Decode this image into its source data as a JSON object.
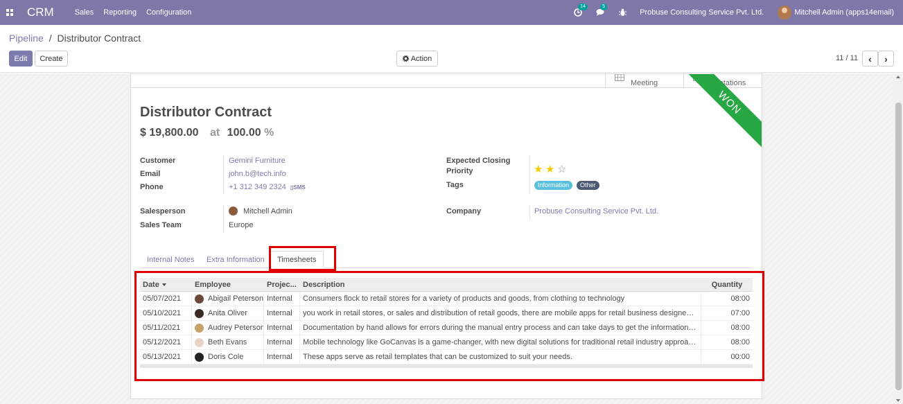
{
  "navbar": {
    "brand": "CRM",
    "menu": [
      "Sales",
      "Reporting",
      "Configuration"
    ],
    "activity_count": "14",
    "message_count": "5",
    "company": "Probuse Consulting Service Pvt. Ltd.",
    "user": "Mitchell Admin (apps14email)",
    "color": "#8077a9"
  },
  "breadcrumb": {
    "parent": "Pipeline",
    "separator": "/",
    "current": "Distributor Contract"
  },
  "toolbar": {
    "edit_label": "Edit",
    "create_label": "Create",
    "action_label": "Action"
  },
  "pager": {
    "value": "11 / 11",
    "prev": "‹",
    "next": "›"
  },
  "smart_buttons": [
    {
      "label": "Meeting",
      "icon": "calendar-icon"
    },
    {
      "label": "Quotations",
      "icon": "pencil-square-icon"
    }
  ],
  "ribbon": {
    "text": "WON",
    "color": "#28a745"
  },
  "lead": {
    "title": "Distributor Contract",
    "revenue": "$ 19,800.00",
    "at": "at",
    "probability": "100.00",
    "percent_sign": "%"
  },
  "fields": {
    "customer": {
      "label": "Customer",
      "value": "Gemini Furniture"
    },
    "email": {
      "label": "Email",
      "value": "john.b@tech.info"
    },
    "phone": {
      "label": "Phone",
      "value": "+1 312 349 2324",
      "sms": "SMS"
    },
    "salesperson": {
      "label": "Salesperson",
      "value": "Mitchell Admin"
    },
    "sales_team": {
      "label": "Sales Team",
      "value": "Europe"
    },
    "expected_closing": {
      "label": "Expected Closing",
      "value": ""
    },
    "priority": {
      "label": "Priority",
      "stars": 2,
      "max": 3
    },
    "tags": {
      "label": "Tags",
      "items": [
        {
          "name": "Information",
          "color": "#5bc0de"
        },
        {
          "name": "Other",
          "color": "#4c5a73"
        }
      ]
    },
    "company": {
      "label": "Company",
      "value": "Probuse Consulting Service Pvt. Ltd."
    }
  },
  "tabs": [
    {
      "label": "Internal Notes"
    },
    {
      "label": "Extra Information"
    },
    {
      "label": "Timesheets",
      "active": true
    }
  ],
  "timesheet": {
    "columns": {
      "date": "Date",
      "employee": "Employee",
      "project": "Projec...",
      "description": "Description",
      "quantity": "Quantity"
    },
    "rows": [
      {
        "date": "05/07/2021",
        "employee": "Abigail Peterson",
        "project": "Internal",
        "description": "Consumers flock to retail stores for a variety of products and goods, from clothing to technology",
        "quantity": "08:00"
      },
      {
        "date": "05/10/2021",
        "employee": "Anita Oliver",
        "project": "Internal",
        "description": "you work in retail stores, or sales and distribution of retail goods, there are mobile apps for retail business designed to help...",
        "quantity": "07:00"
      },
      {
        "date": "05/11/2021",
        "employee": "Audrey Peterson",
        "project": "Internal",
        "description": "Documentation by hand allows for errors during the manual entry process and can take days to get the information actuall...",
        "quantity": "08:00"
      },
      {
        "date": "05/12/2021",
        "employee": "Beth Evans",
        "project": "Internal",
        "description": "Mobile technology like GoCanvas is a game-changer, with new digital solutions for traditional retail industry approaches to ...",
        "quantity": "08:00"
      },
      {
        "date": "05/13/2021",
        "employee": "Doris Cole",
        "project": "Internal",
        "description": "These apps serve as retail templates that can be customized to suit your needs.",
        "quantity": "00:00"
      }
    ]
  },
  "highlight_color": "#e00000"
}
